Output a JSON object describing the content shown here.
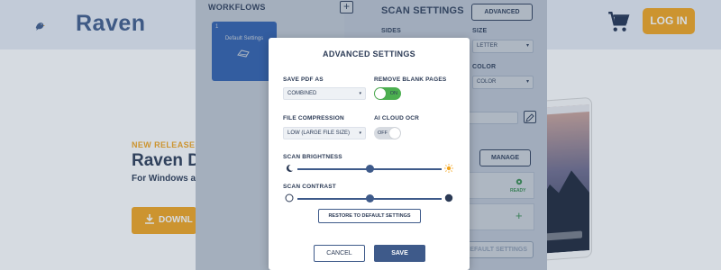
{
  "site": {
    "logo_text": "Raven",
    "login_label": "LOG IN",
    "hero": {
      "badge": "NEW RELEASE",
      "title": "Raven D",
      "subtitle": "For Windows ar",
      "download_label": "DOWNL"
    },
    "colors": {
      "brand": "#3e5a8a",
      "accent": "#f3a51d",
      "header_bg": "#e6ebf4"
    }
  },
  "app": {
    "workflows": {
      "title": "WORKFLOWS",
      "add_symbol": "+",
      "cards": [
        {
          "number": "1",
          "label": "Default Settings"
        }
      ]
    },
    "scan_settings": {
      "title": "SCAN SETTINGS",
      "advanced_label": "ADVANCED",
      "sides_label": "SIDES",
      "size_label": "SIZE",
      "size_value": "LETTER",
      "color_label": "COLOR",
      "color_value": "COLOR",
      "manage_label": "MANAGE",
      "ready_label": "READY",
      "plus_symbol": "+",
      "default_label": "DEFAULT SETTINGS"
    }
  },
  "modal": {
    "title": "ADVANCED SETTINGS",
    "save_pdf_as": {
      "label": "SAVE PDF AS",
      "value": "COMBINED"
    },
    "remove_blank_pages": {
      "label": "REMOVE BLANK PAGES",
      "state": "ON"
    },
    "file_compression": {
      "label": "FILE COMPRESSION",
      "value": "LOW (LARGE FILE SIZE)"
    },
    "ai_cloud_ocr": {
      "label": "AI CLOUD OCR",
      "state": "OFF"
    },
    "brightness": {
      "label": "SCAN BRIGHTNESS",
      "level": 0.5
    },
    "contrast": {
      "label": "SCAN CONTRAST",
      "level": 0.5
    },
    "restore_label": "RESTORE TO DEFAULT SETTINGS",
    "cancel_label": "CANCEL",
    "save_label": "SAVE",
    "icons": {
      "caret": "▾",
      "brightness_low": "moon-icon",
      "brightness_high": "sun-icon",
      "contrast_low": "circle-outline-icon",
      "contrast_high": "circle-filled-icon"
    }
  }
}
